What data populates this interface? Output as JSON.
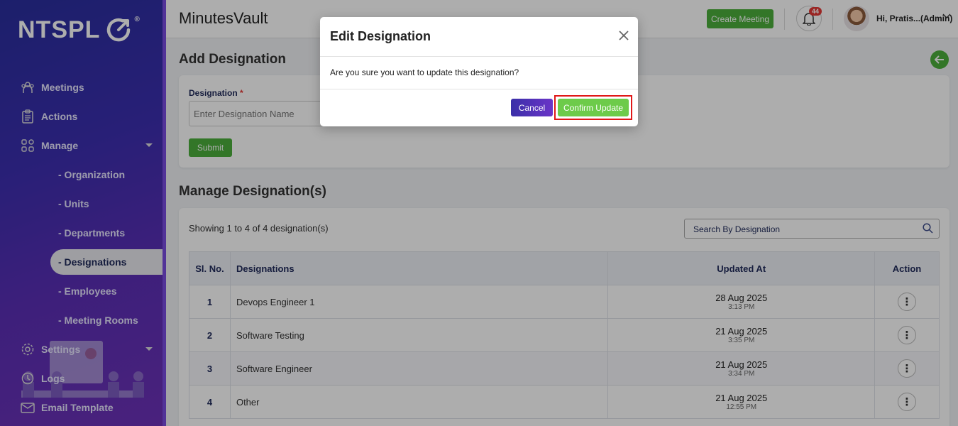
{
  "sidebar": {
    "logo": "NTSPL",
    "logo_reg": "®",
    "items": [
      {
        "label": "Meetings"
      },
      {
        "label": "Actions"
      },
      {
        "label": "Manage"
      },
      {
        "label": "Settings"
      },
      {
        "label": "Logs"
      },
      {
        "label": "Email Template"
      }
    ],
    "sub_items": [
      {
        "label": "- Organization"
      },
      {
        "label": "- Units"
      },
      {
        "label": "- Departments"
      },
      {
        "label": "- Designations"
      },
      {
        "label": "- Employees"
      },
      {
        "label": "- Meeting Rooms"
      }
    ]
  },
  "header": {
    "app_title": "MinutesVault",
    "create_meeting": "Create Meeting",
    "notification_count": "44",
    "user_name": "Hi, Pratis...(Admin)"
  },
  "add_section": {
    "title": "Add Designation",
    "field_label": "Designation",
    "required_mark": "*",
    "placeholder": "Enter Designation Name",
    "submit": "Submit"
  },
  "manage_section": {
    "title": "Manage Designation(s)",
    "showing": "Showing 1 to 4 of 4 designation(s)",
    "search_placeholder": "Search By Designation",
    "columns": {
      "sl": "Sl. No.",
      "designation": "Designations",
      "updated": "Updated At",
      "action": "Action"
    },
    "rows": [
      {
        "sl": "1",
        "name": "Devops Engineer 1",
        "date": "28 Aug 2025",
        "time": "3:13 PM"
      },
      {
        "sl": "2",
        "name": "Software Testing",
        "date": "21 Aug 2025",
        "time": "3:35 PM"
      },
      {
        "sl": "3",
        "name": "Software Engineer",
        "date": "21 Aug 2025",
        "time": "3:34 PM"
      },
      {
        "sl": "4",
        "name": "Other",
        "date": "21 Aug 2025",
        "time": "12:55 PM"
      }
    ]
  },
  "modal": {
    "title": "Edit Designation",
    "message": "Are you sure you want to update this designation?",
    "cancel": "Cancel",
    "confirm": "Confirm Update"
  },
  "colors": {
    "primary_green": "#4caf3c",
    "sidebar_gradient_start": "#2a2f9e",
    "sidebar_gradient_end": "#6d32b8",
    "highlight_red": "#e01818"
  }
}
